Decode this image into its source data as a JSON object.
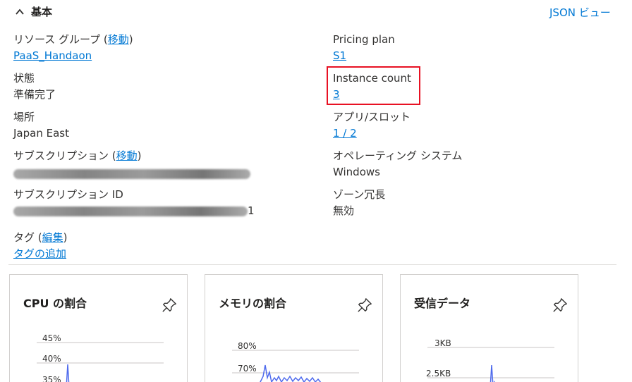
{
  "section": {
    "title": "基本",
    "json_view": "JSON ビュー"
  },
  "left": {
    "resource_group": {
      "label": "リソース グループ (",
      "move": "移動",
      "close": ")",
      "value": "PaaS_Handaon"
    },
    "status": {
      "label": "状態",
      "value": "準備完了"
    },
    "location": {
      "label": "場所",
      "value": "Japan East"
    },
    "subscription": {
      "label": "サブスクリプション (",
      "move": "移動",
      "close": ")"
    },
    "subscription_id": {
      "label": "サブスクリプション ID",
      "value_tail": "1"
    },
    "tags": {
      "label": "タグ (",
      "edit": "編集",
      "close": ")",
      "add": "タグの追加"
    }
  },
  "right": {
    "pricing_plan": {
      "label": "Pricing plan",
      "value": "S1"
    },
    "instance_count": {
      "label": "Instance count",
      "value": "3"
    },
    "apps_slots": {
      "label": "アプリ/スロット",
      "value": "1 / 2"
    },
    "os": {
      "label": "オペレーティング システム",
      "value": "Windows"
    },
    "zone_redundancy": {
      "label": "ゾーン冗長",
      "value": "無効"
    }
  },
  "cards": [
    {
      "title": "CPU の割合",
      "ticks": [
        "45%",
        "40%",
        "35%"
      ]
    },
    {
      "title": "メモリの割合",
      "ticks": [
        "80%",
        "70%"
      ]
    },
    {
      "title": "受信データ",
      "ticks": [
        "3KB",
        "2.5KB"
      ]
    }
  ],
  "colors": {
    "link": "#0078d4",
    "highlight": "#e81123",
    "series": "#4f6bed"
  },
  "chart_data": [
    {
      "type": "line",
      "title": "CPU の割合",
      "y_ticks": [
        "45%",
        "40%",
        "35%"
      ],
      "series": [
        {
          "values": [
            35,
            35,
            41,
            35,
            34
          ]
        }
      ]
    },
    {
      "type": "line",
      "title": "メモリの割合",
      "y_ticks": [
        "80%",
        "70%"
      ],
      "series": [
        {
          "values": [
            66,
            68,
            72,
            67,
            71,
            66,
            70,
            68,
            69,
            67,
            70,
            68,
            69,
            67,
            68,
            67
          ]
        }
      ]
    },
    {
      "type": "line",
      "title": "受信データ",
      "y_ticks": [
        "3KB",
        "2.5KB"
      ],
      "series": [
        {
          "values": [
            2.3,
            2.35,
            2.6,
            2.3,
            2.3
          ]
        }
      ]
    }
  ]
}
